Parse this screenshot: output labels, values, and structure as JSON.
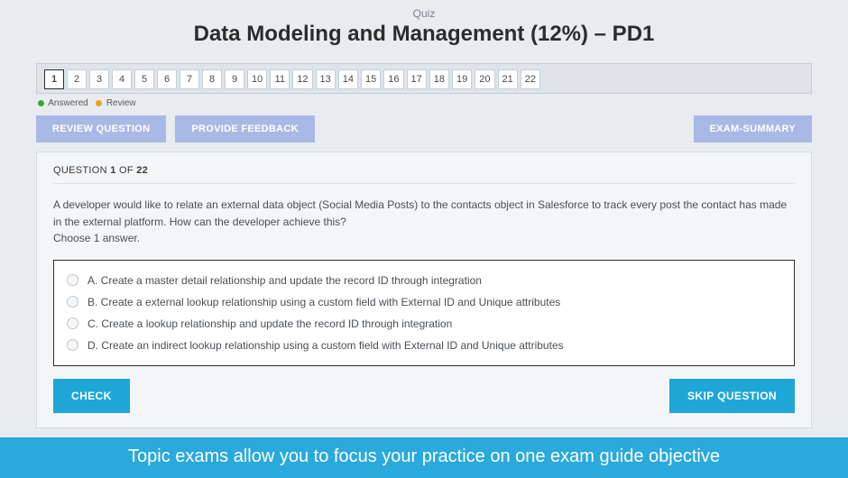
{
  "header": {
    "label": "Quiz",
    "title": "Data Modeling and Management (12%) – PD1"
  },
  "nav": {
    "items": [
      "1",
      "2",
      "3",
      "4",
      "5",
      "6",
      "7",
      "8",
      "9",
      "10",
      "11",
      "12",
      "13",
      "14",
      "15",
      "16",
      "17",
      "18",
      "19",
      "20",
      "21",
      "22"
    ],
    "active_index": 0
  },
  "legend": {
    "answered": "Answered",
    "review": "Review"
  },
  "actions": {
    "review": "REVIEW QUESTION",
    "feedback": "PROVIDE FEEDBACK",
    "summary": "EXAM-SUMMARY"
  },
  "question": {
    "label_prefix": "QUESTION ",
    "current": "1",
    "of_word": " OF ",
    "total": "22",
    "prompt_line1": "A developer would like to relate an external data object (Social Media Posts) to the contacts object in Salesforce to track every post the contact has made in the external platform. How can the developer achieve this?",
    "prompt_line2": "Choose 1 answer.",
    "answers": [
      "A. Create a master detail relationship and update the record ID through integration",
      "B. Create a external lookup relationship using a custom field with External ID and Unique attributes",
      "C. Create a lookup relationship and update the record ID through integration",
      "D. Create an indirect lookup relationship using a custom field with External ID and Unique attributes"
    ]
  },
  "bottom": {
    "check": "CHECK",
    "skip": "SKIP QUESTION"
  },
  "banner": "Topic exams allow you to focus your practice on one exam guide objective"
}
